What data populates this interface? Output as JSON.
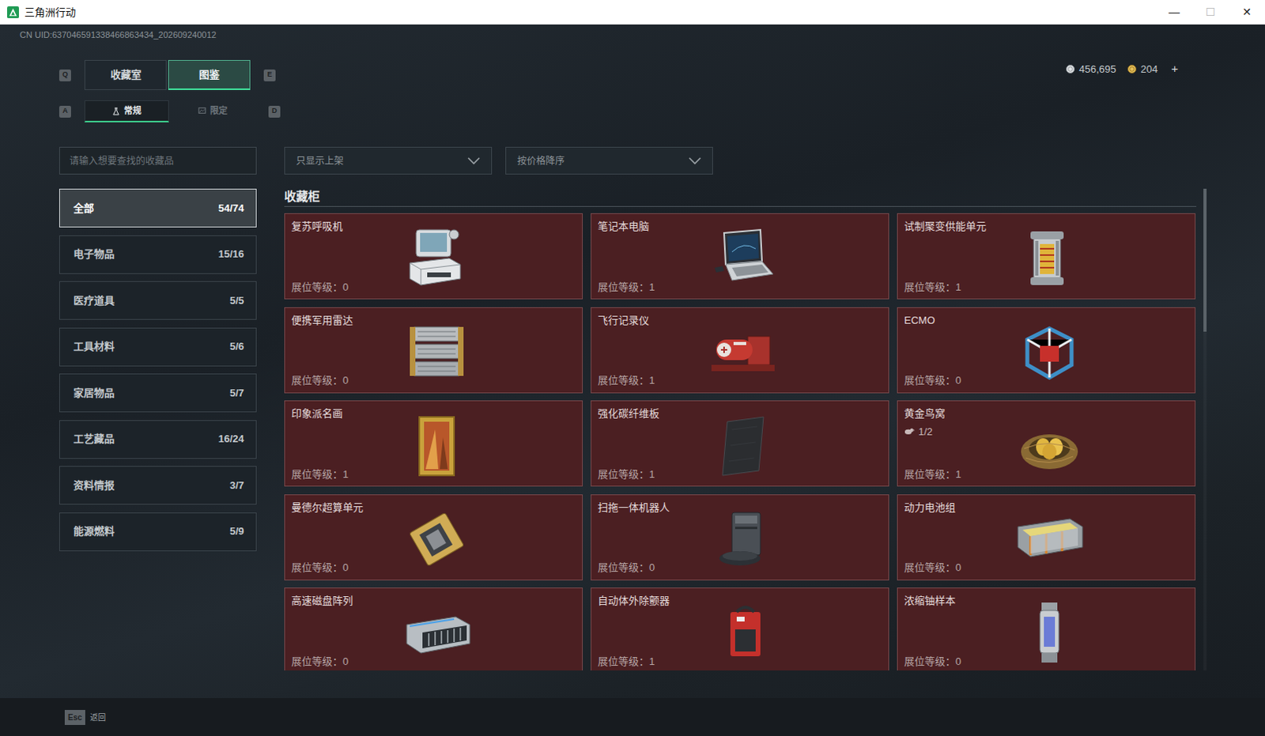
{
  "window": {
    "title": "三角洲行动",
    "controls": [
      {
        "glyph": "—",
        "disabled": false
      },
      {
        "glyph": "☐",
        "disabled": true
      },
      {
        "glyph": "✕",
        "disabled": false
      }
    ]
  },
  "uid": "CN UID:637046591338466863434_202609240012",
  "currency": {
    "items": [
      {
        "amount": "456,695",
        "kind": "silver"
      },
      {
        "amount": "204",
        "kind": "gold"
      }
    ],
    "add": "+"
  },
  "tabs": {
    "prev_key": "Q",
    "next_key": "E",
    "items": [
      {
        "label": "收藏室",
        "selected": false
      },
      {
        "label": "图鉴",
        "selected": true
      }
    ]
  },
  "subtabs": {
    "prev_key": "A",
    "next_key": "D",
    "items": [
      {
        "label": "常规",
        "selected": true,
        "kind": "regular"
      },
      {
        "label": "限定",
        "selected": false,
        "kind": "limited"
      }
    ]
  },
  "search": {
    "placeholder": "请输入想要查找的收藏品"
  },
  "filters": [
    {
      "label": "只显示上架"
    },
    {
      "label": "按价格降序"
    }
  ],
  "sidebar": {
    "items": [
      {
        "label": "全部",
        "count": "54/74",
        "selected": true
      },
      {
        "label": "电子物品",
        "count": "15/16",
        "selected": false
      },
      {
        "label": "医疗道具",
        "count": "5/5",
        "selected": false
      },
      {
        "label": "工具材料",
        "count": "5/6",
        "selected": false
      },
      {
        "label": "家居物品",
        "count": "5/7",
        "selected": false
      },
      {
        "label": "工艺藏品",
        "count": "16/24",
        "selected": false
      },
      {
        "label": "资料情报",
        "count": "3/7",
        "selected": false
      },
      {
        "label": "能源燃料",
        "count": "5/9",
        "selected": false
      }
    ]
  },
  "section": {
    "title": "收藏柜"
  },
  "cabinet": {
    "level_label": "展位等级：",
    "items": [
      {
        "name": "复苏呼吸机",
        "booth_level": "0",
        "kind": "ventilator"
      },
      {
        "name": "笔记本电脑",
        "booth_level": "1",
        "kind": "laptop"
      },
      {
        "name": "试制聚变供能单元",
        "booth_level": "1",
        "kind": "reactor"
      },
      {
        "name": "便携军用雷达",
        "booth_level": "0",
        "kind": "radar"
      },
      {
        "name": "飞行记录仪",
        "booth_level": "1",
        "kind": "recorder"
      },
      {
        "name": "ECMO",
        "booth_level": "0",
        "kind": "ecmo"
      },
      {
        "name": "印象派名画",
        "booth_level": "1",
        "kind": "painting"
      },
      {
        "name": "强化碳纤维板",
        "booth_level": "1",
        "kind": "plate"
      },
      {
        "name": "黄金鸟窝",
        "booth_level": "1",
        "kind": "nest",
        "count": "1/2"
      },
      {
        "name": "曼德尔超算单元",
        "booth_level": "0",
        "kind": "chip"
      },
      {
        "name": "扫拖一体机器人",
        "booth_level": "0",
        "kind": "robot"
      },
      {
        "name": "动力电池组",
        "booth_level": "0",
        "kind": "battery"
      },
      {
        "name": "高速磁盘阵列",
        "booth_level": "0",
        "kind": "disk"
      },
      {
        "name": "自动体外除颤器",
        "booth_level": "1",
        "kind": "defib"
      },
      {
        "name": "浓缩铀样本",
        "booth_level": "0",
        "kind": "uranium"
      }
    ]
  },
  "footer": {
    "key": "Esc",
    "label": "返回"
  }
}
